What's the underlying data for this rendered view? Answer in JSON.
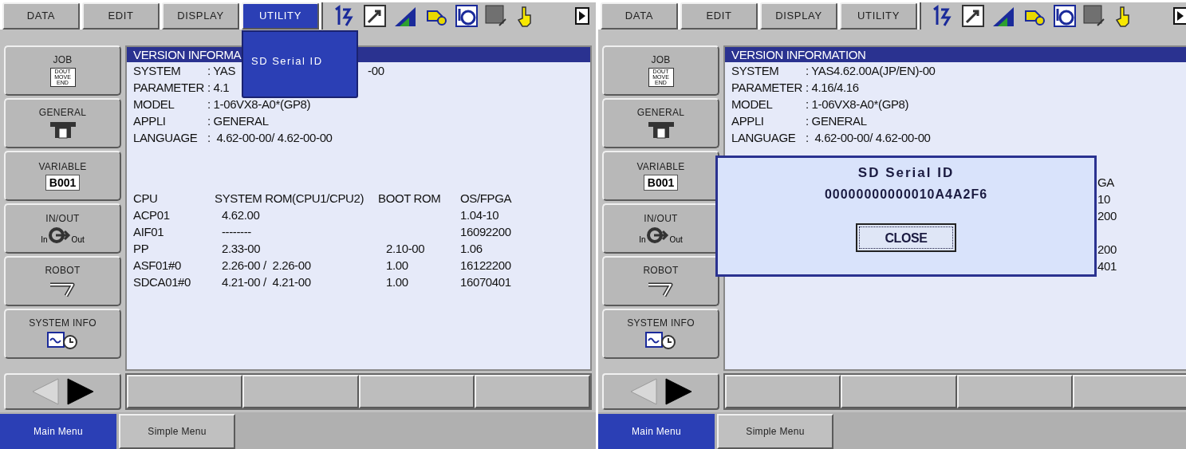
{
  "panels": [
    {
      "menu_tabs": [
        {
          "label": "DATA",
          "selected": false
        },
        {
          "label": "EDIT",
          "selected": false
        },
        {
          "label": "DISPLAY",
          "selected": false
        },
        {
          "label": "UTILITY",
          "selected": true
        }
      ],
      "dropdown": {
        "items": [
          "SD Serial ID"
        ]
      },
      "side_buttons": [
        {
          "kind": "job",
          "label": "JOB",
          "icon_text": [
            "DOUT",
            "MOVE",
            "END"
          ]
        },
        {
          "kind": "general",
          "label": "GENERAL"
        },
        {
          "kind": "variable",
          "label": "VARIABLE",
          "value": "B001"
        },
        {
          "kind": "inout",
          "label": "IN/OUT",
          "icon_text": [
            "In",
            "Out"
          ]
        },
        {
          "kind": "robot",
          "label": "ROBOT"
        },
        {
          "kind": "sysinfo",
          "label": "SYSTEM INFO"
        }
      ],
      "page_arrows": [
        {
          "disabled": true
        },
        {
          "disabled": false
        }
      ],
      "info": {
        "title": "VERSION INFORMA",
        "lines": [
          {
            "label": "SYSTEM",
            "value": ": YAS",
            "tail": "-00"
          },
          {
            "label": "PARAMETER",
            "value": ": 4.1"
          },
          {
            "label": "MODEL",
            "value": ": 1-06VX8-A0*(GP8)"
          },
          {
            "label": "APPLI",
            "value": ": GENERAL"
          },
          {
            "label": "LANGUAGE",
            "value": ":  4.62-00-00/ 4.62-00-00"
          }
        ]
      },
      "cpu_table": {
        "columns": [
          "CPU",
          "SYSTEM ROM(CPU1/CPU2)",
          "BOOT ROM",
          "OS/FPGA"
        ],
        "rows": [
          {
            "cpu": "ACP01",
            "system_rom": "4.62.00",
            "os_fpga": "1.04-10"
          },
          {
            "cpu": "AIF01",
            "system_rom": "--------",
            "os_fpga": "16092200"
          },
          {
            "cpu": "PP",
            "system_rom": "2.33-00",
            "boot_rom": "2.10-00",
            "os_fpga": "1.06"
          },
          {
            "cpu": "ASF01#0",
            "system_rom": "2.26-00 /  2.26-00",
            "boot_rom": "1.00",
            "os_fpga": "16122200"
          },
          {
            "cpu": "SDCA01#0",
            "system_rom": "4.21-00 /  4.21-00",
            "boot_rom": "1.00",
            "os_fpga": "16070401"
          }
        ]
      },
      "footer_tabs": [
        {
          "label": "Main Menu",
          "selected": true
        },
        {
          "label": "Simple Menu",
          "selected": false
        }
      ]
    },
    {
      "menu_tabs": [
        {
          "label": "DATA",
          "selected": false
        },
        {
          "label": "EDIT",
          "selected": false
        },
        {
          "label": "DISPLAY",
          "selected": false
        },
        {
          "label": "UTILITY",
          "selected": false
        }
      ],
      "side_buttons": [
        {
          "kind": "job",
          "label": "JOB",
          "icon_text": [
            "DOUT",
            "MOVE",
            "END"
          ]
        },
        {
          "kind": "general",
          "label": "GENERAL"
        },
        {
          "kind": "variable",
          "label": "VARIABLE",
          "value": "B001"
        },
        {
          "kind": "inout",
          "label": "IN/OUT",
          "icon_text": [
            "In",
            "Out"
          ]
        },
        {
          "kind": "robot",
          "label": "ROBOT"
        },
        {
          "kind": "sysinfo",
          "label": "SYSTEM INFO"
        }
      ],
      "page_arrows": [
        {
          "disabled": true
        },
        {
          "disabled": false
        }
      ],
      "info": {
        "title": "VERSION INFORMATION",
        "lines": [
          {
            "label": "SYSTEM",
            "value": ": YAS4.62.00A(JP/EN)-00"
          },
          {
            "label": "PARAMETER",
            "value": ": 4.16/4.16"
          },
          {
            "label": "MODEL",
            "value": ": 1-06VX8-A0*(GP8)"
          },
          {
            "label": "APPLI",
            "value": ": GENERAL"
          },
          {
            "label": "LANGUAGE",
            "value": ":  4.62-00-00/ 4.62-00-00"
          }
        ]
      },
      "dialog": {
        "title": "SD Serial ID",
        "value": "00000000000010A4A2F6",
        "button": "CLOSE"
      },
      "cpu_fragments": [
        "GA",
        "10",
        "200",
        "200",
        "401"
      ],
      "footer_tabs": [
        {
          "label": "Main Menu",
          "selected": true
        },
        {
          "label": "Simple Menu",
          "selected": false
        }
      ]
    }
  ]
}
